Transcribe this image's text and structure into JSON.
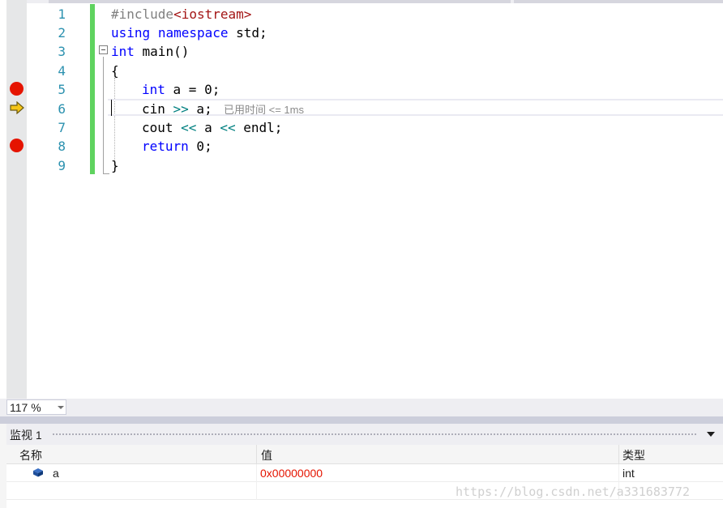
{
  "editor": {
    "line_numbers": [
      "1",
      "2",
      "3",
      "4",
      "5",
      "6",
      "7",
      "8",
      "9"
    ],
    "breakpoint_lines": [
      5,
      8
    ],
    "current_line": 6,
    "code": {
      "l1_directive": "#include",
      "l1_header": "<iostream>",
      "l2_using": "using",
      "l2_namespace": "namespace",
      "l2_rest": " std;",
      "l3_type": "int",
      "l3_rest": " main()",
      "l4": "{",
      "l5_type": "int",
      "l5_rest": " a = 0;",
      "l6_a": "cin ",
      "l6_op": ">>",
      "l6_b": " a;",
      "l7_a": "cout ",
      "l7_op1": "<<",
      "l7_b": " a ",
      "l7_op2": "<<",
      "l7_c": " endl;",
      "l8_kw": "return",
      "l8_rest": " 0;",
      "l9": "}"
    },
    "perf_tip": "已用时间 <= 1ms"
  },
  "zoom": {
    "value": "117 %"
  },
  "watch": {
    "title": "监视 1",
    "columns": {
      "name": "名称",
      "value": "值",
      "type": "类型"
    },
    "rows": [
      {
        "name": "a",
        "value": "0x00000000",
        "type": "int"
      }
    ]
  },
  "watermark": "https://blog.csdn.net/a331683772",
  "colors": {
    "breakpoint": "#e51400",
    "changed_bar": "#5fd35f",
    "keyword": "#0000ff",
    "changed_value": "#e51400",
    "line_number": "#2b91af"
  }
}
